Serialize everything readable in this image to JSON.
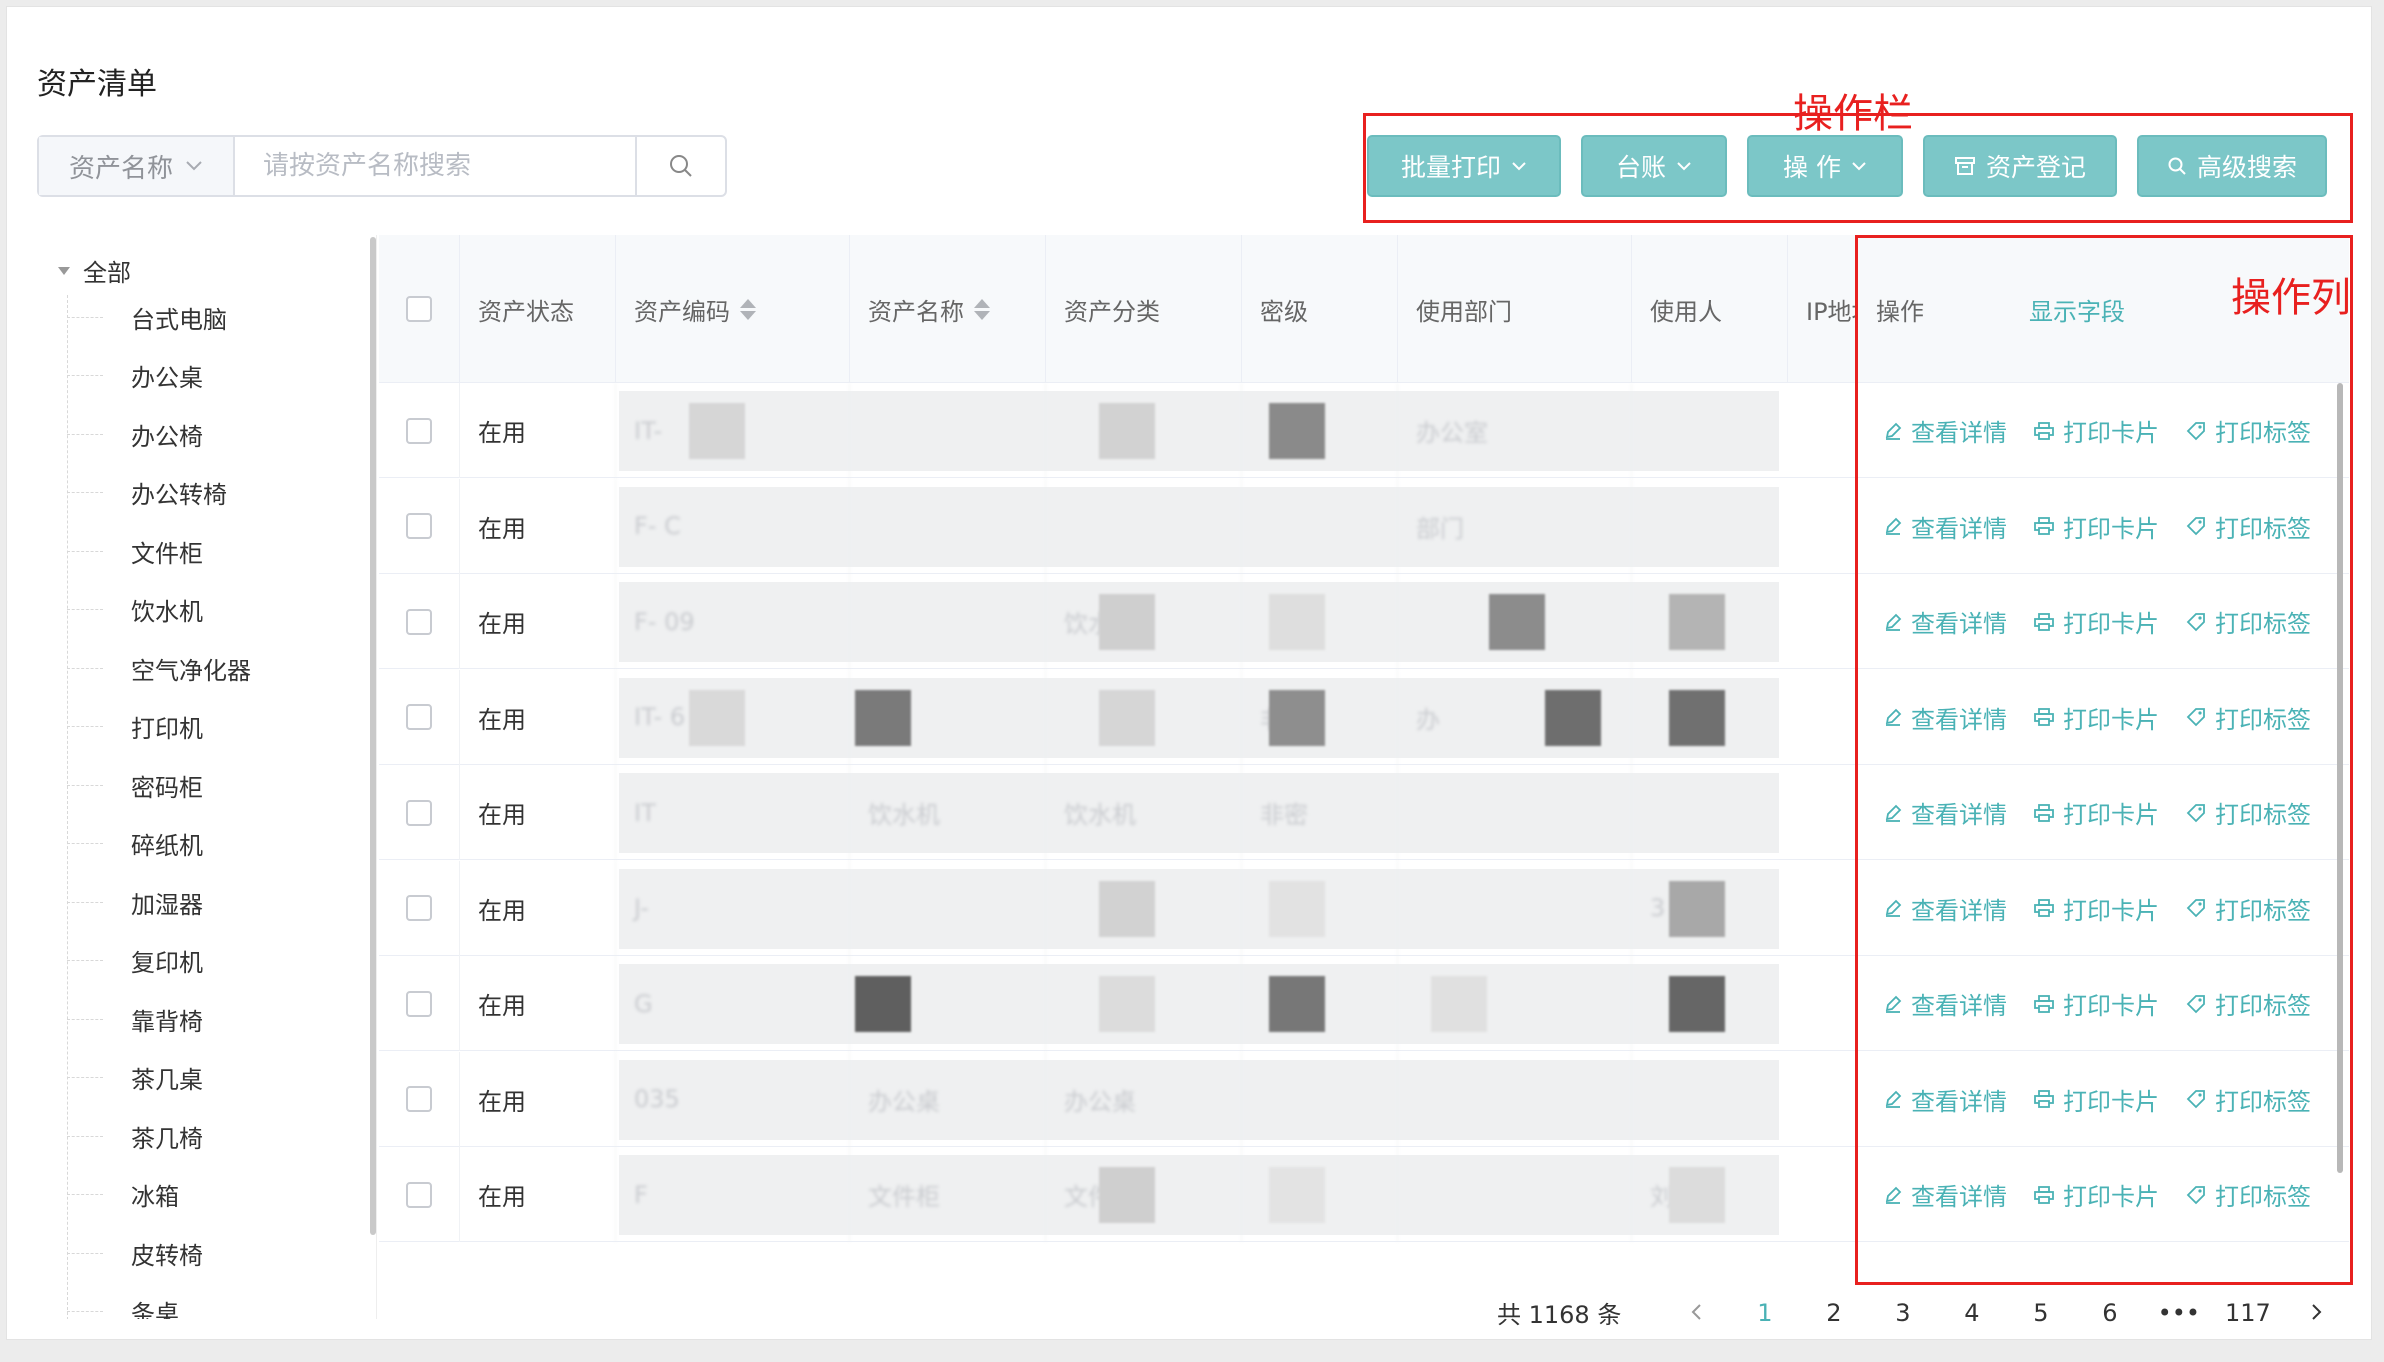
{
  "title": "资产清单",
  "search": {
    "field": "资产名称",
    "placeholder": "请按资产名称搜索"
  },
  "toolbar": {
    "batch_print": "批量打印",
    "ledger": "台账",
    "operate": "操 作",
    "register": "资产登记",
    "advanced_search": "高级搜索"
  },
  "tree": {
    "root": "全部",
    "items": [
      "台式电脑",
      "办公桌",
      "办公椅",
      "办公转椅",
      "文件柜",
      "饮水机",
      "空气净化器",
      "打印机",
      "密码柜",
      "碎纸机",
      "加湿器",
      "复印机",
      "靠背椅",
      "茶几桌",
      "茶几椅",
      "冰箱",
      "皮转椅",
      "条桌"
    ]
  },
  "table": {
    "columns": {
      "status": "资产状态",
      "code": "资产编码",
      "name": "资产名称",
      "category": "资产分类",
      "secret": "密级",
      "dept": "使用部门",
      "user": "使用人",
      "ip": "IP地址",
      "actions": "操作",
      "show_fields": "显示字段"
    },
    "rows": [
      {
        "status": "在用",
        "code": "IT-",
        "name": "",
        "category": "",
        "secret": "",
        "dept": "办公室",
        "user": ""
      },
      {
        "status": "在用",
        "code": "F-   C",
        "name": "",
        "category": "",
        "secret": "",
        "dept": "部门",
        "user": ""
      },
      {
        "status": "在用",
        "code": "F-  09",
        "name": "",
        "category": "饮水机",
        "secret": "",
        "dept": "",
        "user": ""
      },
      {
        "status": "在用",
        "code": "IT-   6",
        "name": "",
        "category": "",
        "secret": "非密",
        "dept": "办",
        "user": ""
      },
      {
        "status": "在用",
        "code": "IT",
        "name": "饮水机",
        "category": "饮水机",
        "secret": "非密",
        "dept": "",
        "user": ""
      },
      {
        "status": "在用",
        "code": "  J-",
        "name": "",
        "category": "",
        "secret": "",
        "dept": "",
        "user": "3"
      },
      {
        "status": "在用",
        "code": "  G",
        "name": "",
        "category": "",
        "secret": "",
        "dept": "",
        "user": ""
      },
      {
        "status": "在用",
        "code": "  035",
        "name": "办公桌",
        "category": "办公桌",
        "secret": "",
        "dept": "",
        "user": ""
      },
      {
        "status": "在用",
        "code": "F",
        "name": "文件柜",
        "category": "文件",
        "secret": "",
        "dept": "",
        "user": "刘"
      }
    ],
    "row_actions": {
      "view": "查看详情",
      "print_card": "打印卡片",
      "print_label": "打印标签"
    }
  },
  "pagination": {
    "total": "共 1168 条",
    "pages": [
      "1",
      "2",
      "3",
      "4",
      "5",
      "6",
      "•••",
      "117"
    ],
    "current": "1"
  },
  "annotations": {
    "toolbar_label": "操作栏",
    "column_label": "操作列",
    "color": "#e8201f"
  },
  "colors": {
    "accent": "#7cc7c8",
    "link": "#4ab2b5"
  }
}
